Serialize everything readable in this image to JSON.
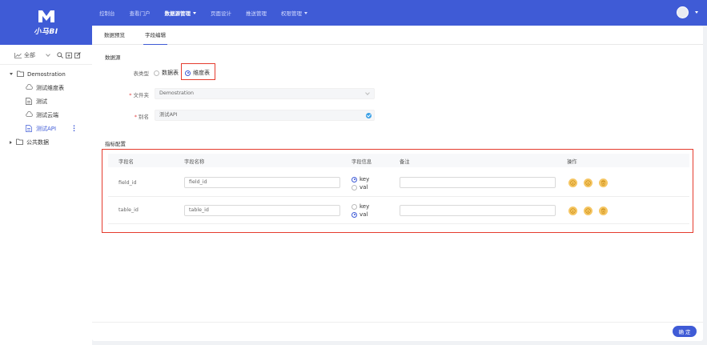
{
  "brand": {
    "name": "小马BI",
    "color": "#3f5bd6"
  },
  "nav": [
    {
      "label": "控制台"
    },
    {
      "label": "查看门户"
    },
    {
      "label": "数据源管理",
      "active": true,
      "dropdown": true
    },
    {
      "label": "页面设计"
    },
    {
      "label": "推送管理"
    },
    {
      "label": "权限管理",
      "dropdown": true
    }
  ],
  "sidebar": {
    "filter": "全部",
    "tree": [
      {
        "label": "Demostration",
        "expanded": true
      },
      {
        "label": "测试维度表"
      },
      {
        "label": "测试"
      },
      {
        "label": "测试云端"
      },
      {
        "label": "测试API",
        "active": true
      },
      {
        "label": "公共数据",
        "expanded": false
      }
    ]
  },
  "tabs": [
    {
      "label": "数据预览"
    },
    {
      "label": "字段编辑",
      "active": true
    }
  ],
  "datasource": {
    "section_title": "数据源",
    "table_type_label": "表类型",
    "options": [
      "数据表",
      "维度表"
    ],
    "selected": "维度表",
    "folder_label": "文件夹",
    "folder_value": "Demostration",
    "alias_label": "别名",
    "alias_value": "测试API"
  },
  "metrics": {
    "section_title": "指标配置",
    "columns": [
      "字段名",
      "字段名称",
      "字段信息",
      "备注",
      "操作"
    ],
    "rows": [
      {
        "field": "field_id",
        "name": "field_id",
        "info_options": [
          "key",
          "val"
        ],
        "info_selected": "key",
        "note": ""
      },
      {
        "field": "table_id",
        "name": "table_id",
        "info_options": [
          "key",
          "val"
        ],
        "info_selected": "val",
        "note": ""
      }
    ],
    "op_icons": [
      "info-icon",
      "info-icon",
      "trash-icon"
    ]
  },
  "footer": {
    "confirm_label": "确 定"
  },
  "colors": {
    "highlight": "#e53c2e",
    "op_icon": "#f5c663",
    "check": "#3aa0e6"
  }
}
